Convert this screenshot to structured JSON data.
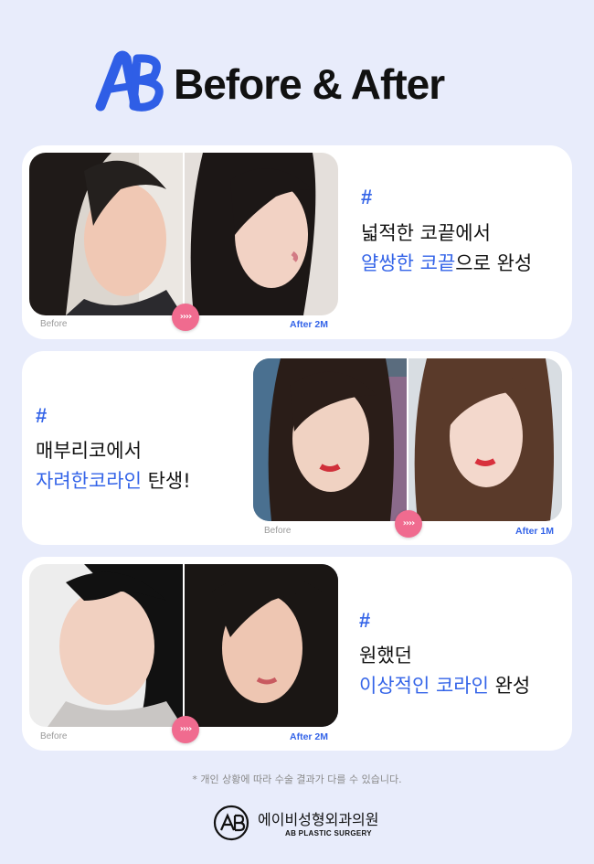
{
  "header": {
    "logo_text": "AB",
    "title": "Before & After"
  },
  "cards": [
    {
      "before_label": "Before",
      "after_label": "After 2M",
      "arrow_glyph": "››››",
      "hash": "#",
      "line1": "넓적한 코끝에서",
      "line2_highlight": "얄쌍한 코끝",
      "line2_rest": "으로 완성"
    },
    {
      "before_label": "Before",
      "after_label": "After 1M",
      "arrow_glyph": "››››",
      "hash": "#",
      "line1": "매부리코에서",
      "line2_highlight": "자려한코라인",
      "line2_rest": " 탄생!"
    },
    {
      "before_label": "Before",
      "after_label": "After 2M",
      "arrow_glyph": "››››",
      "hash": "#",
      "line1": "원했던",
      "line2_highlight": "이상적인 코라인",
      "line2_rest": " 완성"
    }
  ],
  "disclaimer": "* 개인 상황에 따라 수술 결과가 다를 수 있습니다.",
  "footer": {
    "logo_text": "AB",
    "clinic_name": "에이비성형외과의원",
    "clinic_name_en": "AB PLASTIC SURGERY"
  },
  "colors": {
    "accent": "#3464e8",
    "background": "#e8ecfb",
    "arrow": "#f06b8f"
  }
}
